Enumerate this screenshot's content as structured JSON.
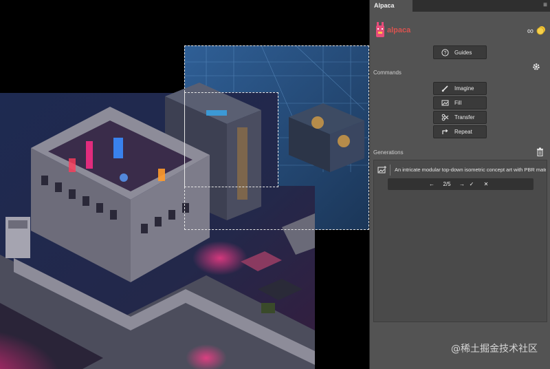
{
  "panel": {
    "tab_label": "Alpaca",
    "menu_icon": "hamburger-menu-icon",
    "logo_text": "alpaca",
    "credits_label": "∞",
    "guides_label": "Guides",
    "commands_label": "Commands",
    "commands": [
      {
        "label": "Imagine",
        "icon": "brush-icon"
      },
      {
        "label": "Fill",
        "icon": "image-fill-icon"
      },
      {
        "label": "Transfer",
        "icon": "transfer-icon"
      },
      {
        "label": "Repeat",
        "icon": "repeat-icon"
      }
    ],
    "generations_label": "Generations",
    "generation": {
      "prompt": "An intricate modular top-down isometric concept art with PBR materials",
      "counter": "2/5"
    }
  },
  "watermark": "@稀土掘金技术社区",
  "colors": {
    "panel_bg": "#535353",
    "button_bg": "#3a3a3a",
    "logo_red": "#d9534f",
    "accent_neon_pink": "#ff2d86",
    "accent_neon_blue": "#3a8cff"
  }
}
